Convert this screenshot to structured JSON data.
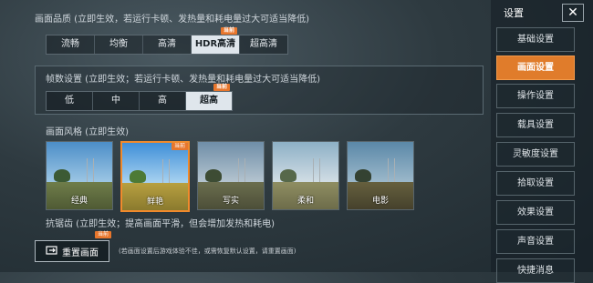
{
  "quality": {
    "label": "画面品质 (立即生效，若运行卡顿、发热量和耗电量过大可适当降低)",
    "tag": "当前",
    "options": [
      "流畅",
      "均衡",
      "高清",
      "HDR高清",
      "超高清"
    ],
    "selected": "HDR高清"
  },
  "fps": {
    "label": "帧数设置 (立即生效；若运行卡顿、发热量和耗电量过大可适当降低)",
    "tag": "当前",
    "options": [
      "低",
      "中",
      "高",
      "超高"
    ],
    "selected": "超高"
  },
  "style": {
    "label": "画面风格 (立即生效)",
    "tag": "当前",
    "options": [
      "经典",
      "鲜艳",
      "写实",
      "柔和",
      "电影"
    ],
    "selected": "鲜艳"
  },
  "antialias": {
    "label": "抗锯齿 (立即生效；提高画面平滑，但会增加发热和耗电)",
    "tag": "当前"
  },
  "reset": {
    "label": "重置画面"
  },
  "note": "(若画面设置后游戏体验不佳，或需恢复默认设置，请重置画面)",
  "sidebar": {
    "title": "设置",
    "close": "✕",
    "items": [
      "基础设置",
      "画面设置",
      "操作设置",
      "载具设置",
      "灵敏度设置",
      "拾取设置",
      "效果设置",
      "声音设置",
      "快捷消息"
    ],
    "active": "画面设置"
  },
  "colors": {
    "accent": "#e07c2b",
    "selected_bg": "#dfe6ec"
  }
}
